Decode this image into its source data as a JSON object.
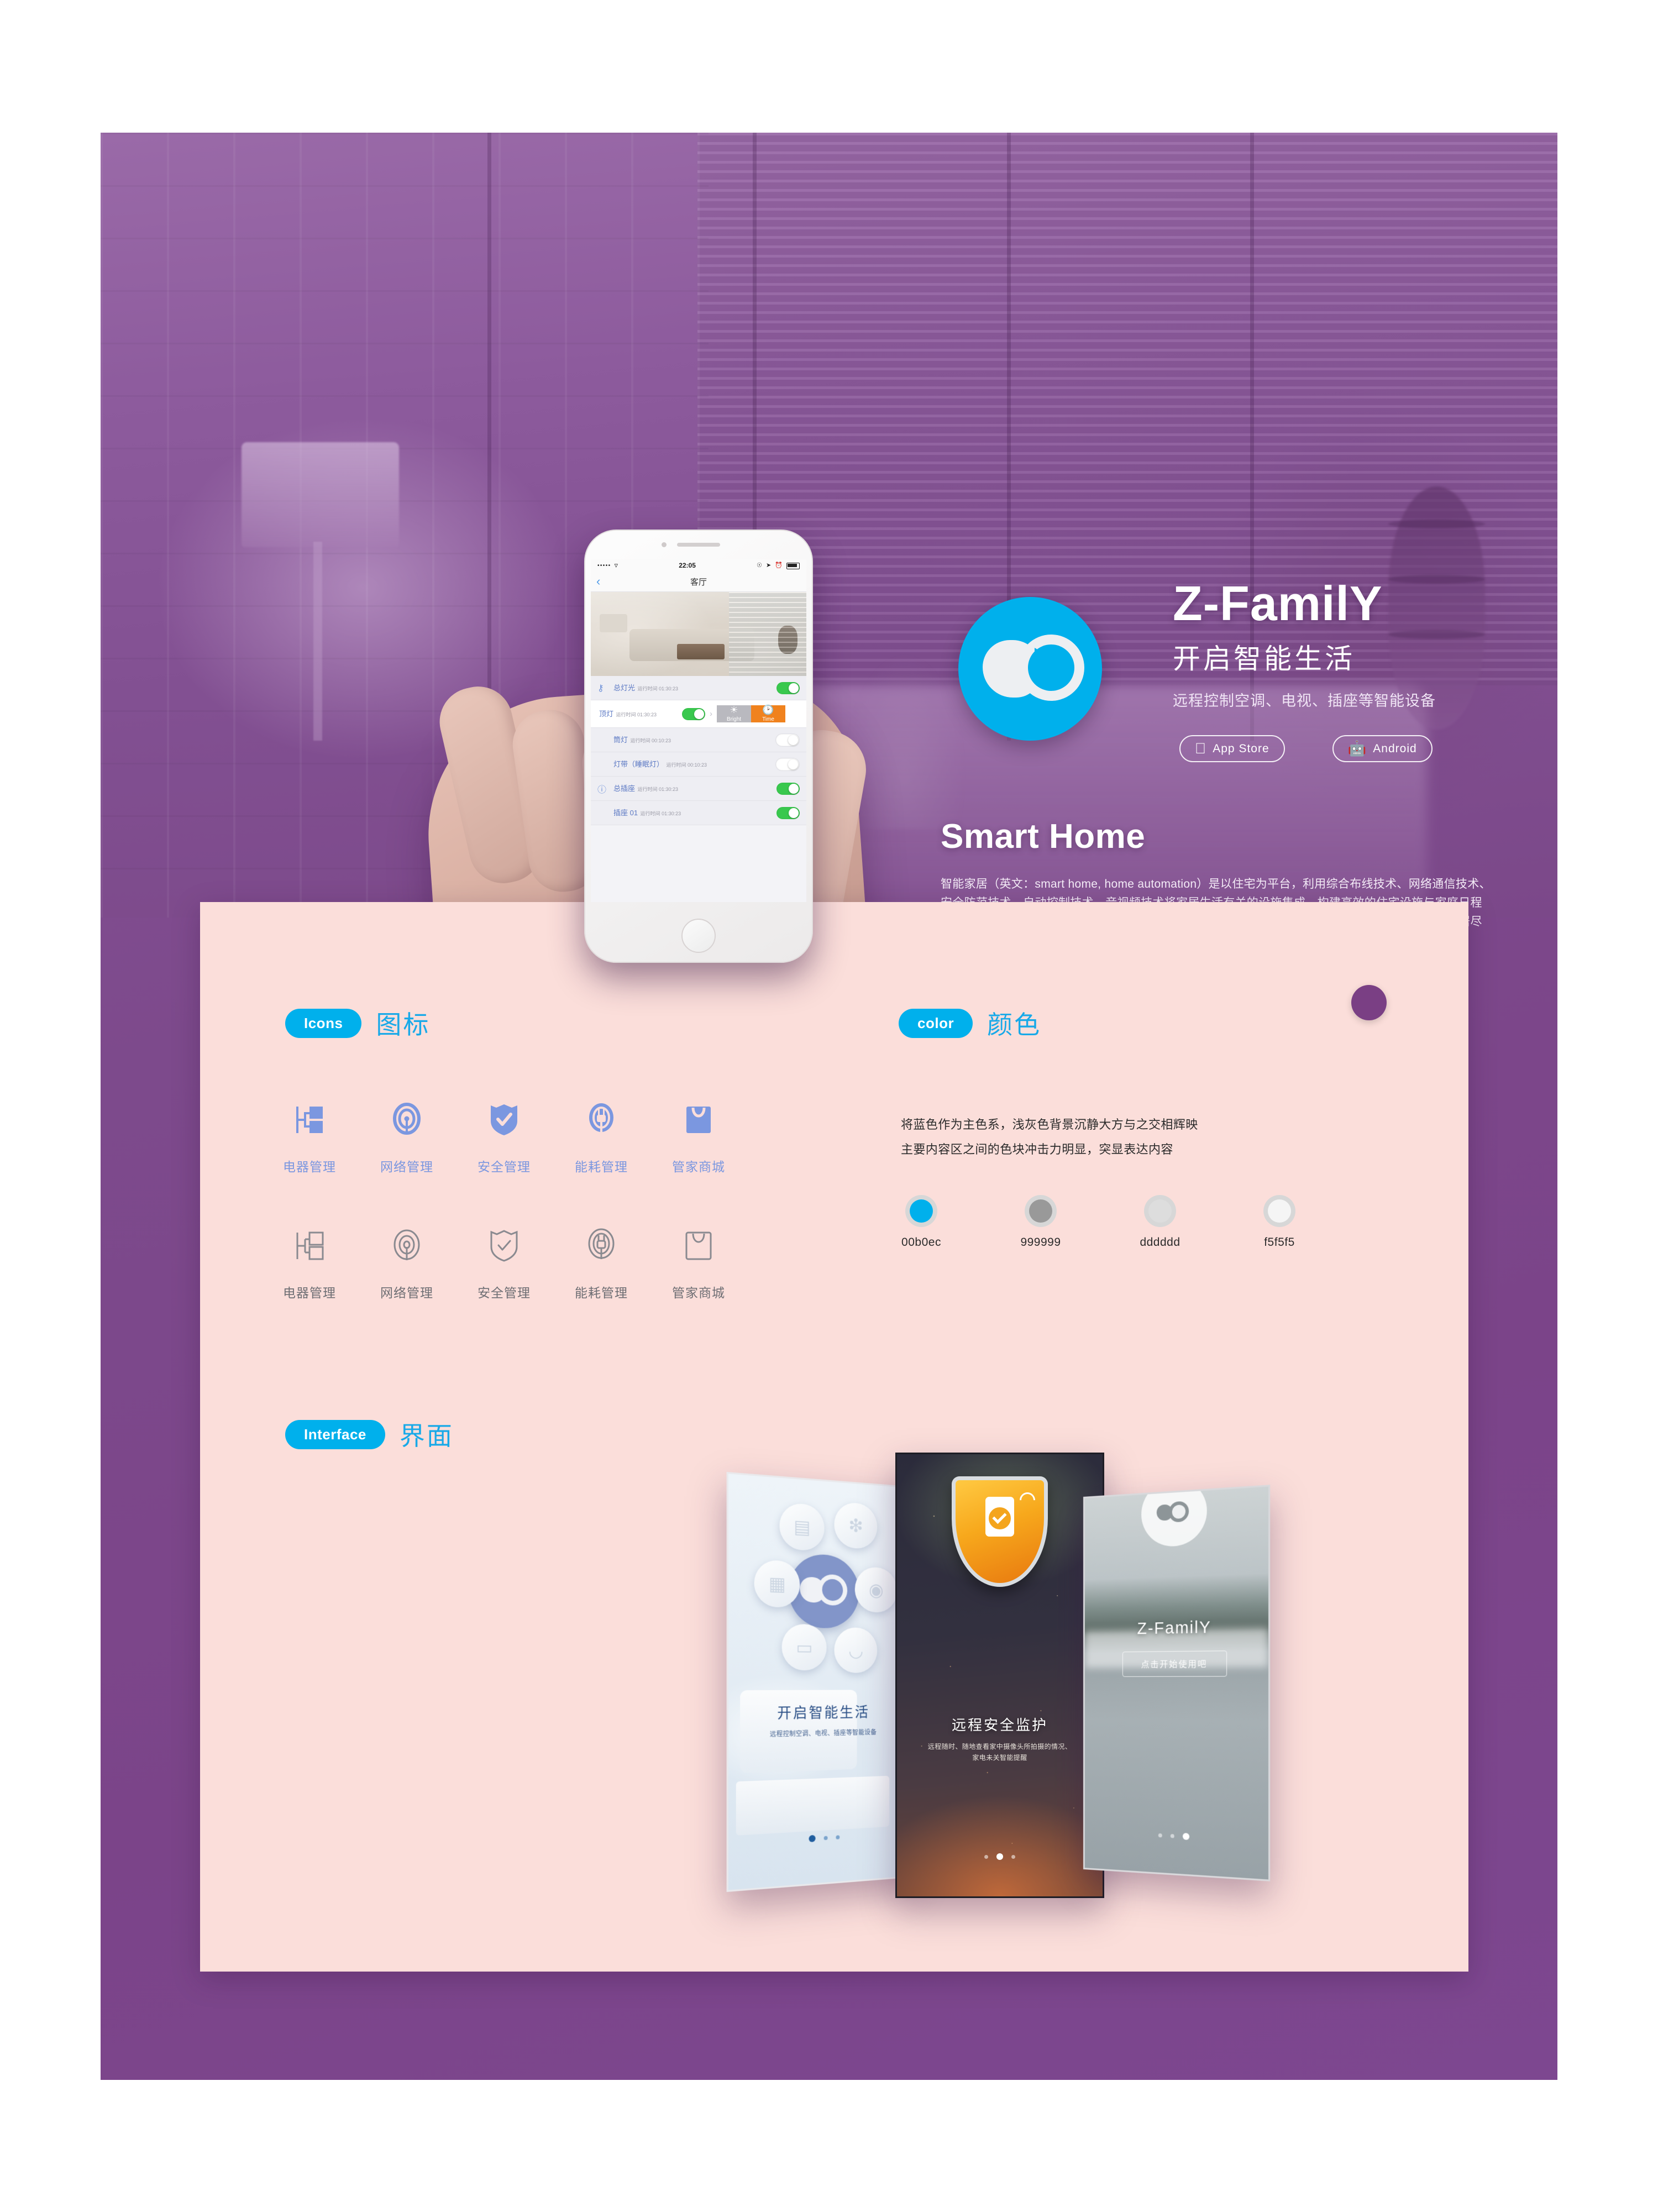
{
  "brand": {
    "name": "Z-FamilY",
    "tagline_cn": "开启智能生活",
    "subtitle_cn": "远程控制空调、电视、插座等智能设备",
    "badges": [
      {
        "label": "App Store",
        "icon": "apple-icon"
      },
      {
        "label": "Android",
        "icon": "android-icon"
      }
    ]
  },
  "smart_home": {
    "heading": "Smart Home",
    "body": "智能家居（英文：smart home, home automation）是以住宅为平台，利用综合布线技术、网络通信技术、安全防范技术、自动控制技术、音视频技术将家居生活有关的设施集成，构建高效的住宅设施与家庭日程事务的管理系统，提升家居安全性、便利性、舒适性、艺术性，并实现环保节能的居住环境，智能家居尽管发展至今，但仍被认为是处于初级发展阶段。"
  },
  "phone": {
    "status_bar": {
      "carrier_dots": "•••••",
      "wifi": "wifi-icon",
      "time": "22:05",
      "battery": "battery-icon"
    },
    "nav": {
      "back": "‹",
      "title": "客厅"
    },
    "devices": [
      {
        "name": "总灯光",
        "runtime_label": "运行时间",
        "runtime": "01:30:23",
        "on": true,
        "icon": "bulb-icon",
        "expanded": false
      },
      {
        "name": "顶灯",
        "runtime_label": "运行时间",
        "runtime": "01:30:23",
        "on": true,
        "icon": "",
        "expanded": true,
        "actions": [
          {
            "label": "Bright",
            "icon": "sun-icon"
          },
          {
            "label": "Time",
            "icon": "clock-icon"
          }
        ]
      },
      {
        "name": "筒灯",
        "runtime_label": "运行时间",
        "runtime": "00:10:23",
        "on": false,
        "icon": "",
        "expanded": false
      },
      {
        "name": "灯带（睡眠灯）",
        "runtime_label": "运行时间",
        "runtime": "00:10:23",
        "on": false,
        "icon": "",
        "expanded": false
      },
      {
        "name": "总插座",
        "runtime_label": "运行时间",
        "runtime": "01:30:23",
        "on": true,
        "icon": "socket-icon",
        "expanded": false
      },
      {
        "name": "插座 01",
        "runtime_label": "运行时间",
        "runtime": "01:30:23",
        "on": true,
        "icon": "",
        "expanded": false
      }
    ]
  },
  "sections": {
    "icons": {
      "pill": "Icons",
      "cn": "图标"
    },
    "color": {
      "pill": "color",
      "cn": "颜色"
    },
    "interface": {
      "pill": "Interface",
      "cn": "界面"
    }
  },
  "icon_set": {
    "labels": [
      "电器管理",
      "网络管理",
      "安全管理",
      "能耗管理",
      "管家商城"
    ],
    "glyphs": [
      "appliance-tree-icon",
      "network-signal-icon",
      "shield-check-icon",
      "energy-plug-icon",
      "shop-bag-icon"
    ],
    "blue": "#7b97e0",
    "gray": "#8a8a90"
  },
  "color_section": {
    "desc_line1": "将蓝色作为主色系，浅灰色背景沉静大方与之交相辉映",
    "desc_line2": "主要内容区之间的色块冲击力明显，突显表达内容",
    "swatches": [
      {
        "label": "00b0ec",
        "hex": "#00b0ec"
      },
      {
        "label": "999999",
        "hex": "#999999"
      },
      {
        "label": "dddddd",
        "hex": "#dddddd"
      },
      {
        "label": "f5f5f5",
        "hex": "#f5f5f5"
      }
    ]
  },
  "mockups": {
    "left": {
      "title": "开启智能生活",
      "desc": "远程控制空调、电视、插座等智能设备",
      "orbit_icons": [
        "air-conditioner-icon",
        "fan-icon",
        "radiator-icon",
        "washer-icon",
        "tv-icon",
        "desk-lamp-icon"
      ],
      "page_index": 1,
      "page_count": 3
    },
    "center": {
      "title": "远程安全监护",
      "desc_line1": "远程随时、随地查看家中摄像头所拍摄的情况、",
      "desc_line2": "家电未关智能提醒",
      "icon": "shield-phone-icon",
      "page_index": 2,
      "page_count": 3
    },
    "right": {
      "title": "Z-FamilY",
      "cta": "点击开始使用吧",
      "icon": "logo-icon",
      "page_index": 3,
      "page_count": 3
    }
  },
  "palette": {
    "purple": "#7b4489",
    "pink_panel": "#fbdeda",
    "accent_blue": "#00b0ec",
    "accent_dot": "#7a3f84"
  }
}
